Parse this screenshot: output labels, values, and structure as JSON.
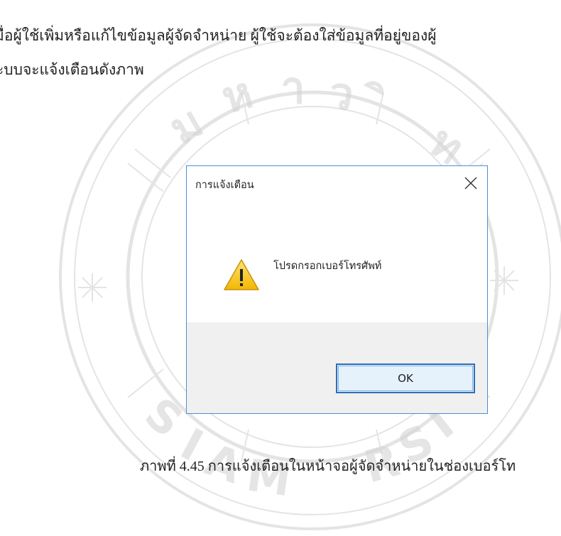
{
  "document": {
    "paragraph_line_1": "มื่อผู้ใช้เพิ่มหรือแก้ไขข้อมูลผู้จัดจำหน่าย ผู้ใช้จะต้องใส่ข้อมูลที่อยู่ของผู้",
    "paragraph_line_2": "ะบบจะแจ้งเตือนดังภาพ",
    "caption": "ภาพที่ 4.45 การแจ้งเตือนในหน้าจอผู้จัดจำหน่ายในช่องเบอร์โท"
  },
  "dialog": {
    "title": "การแจ้งเตือน",
    "message": "โปรดกรอกเบอร์โทรศัพท์",
    "ok_label": "OK",
    "icon": "warning-icon",
    "close_icon": "close-icon"
  },
  "watermark": {
    "brand_mark": "siam-university-seal",
    "color": "#a8a8a8"
  }
}
